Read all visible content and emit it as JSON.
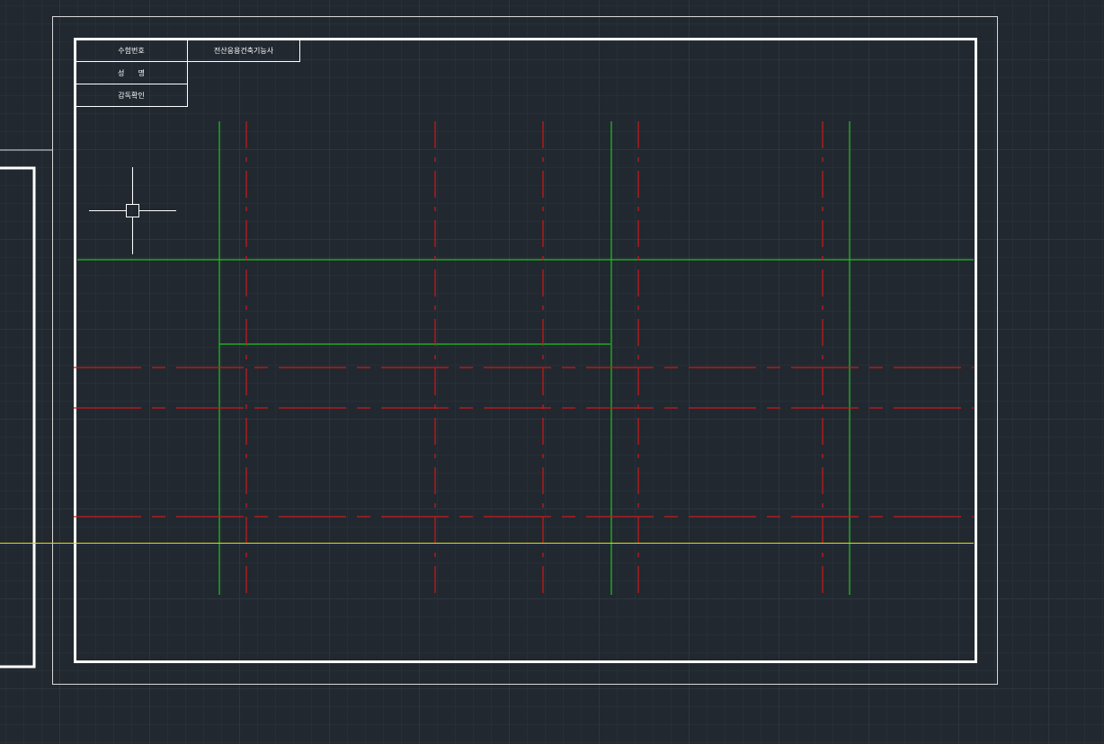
{
  "app": {
    "type": "CAD drawing model space",
    "colors": {
      "background": "#212830",
      "grid_minor": "#2b333d",
      "grid_major": "#36404b",
      "border": "#ffffff",
      "construction_line": "#1fc21f",
      "center_line": "#d01818",
      "baseline": "#e0e000"
    }
  },
  "title_block": {
    "row1_label": "수험번호",
    "row1_value": "전산응용건축기능사",
    "row2_label": "성      명",
    "row3_label": "감독확인"
  },
  "crosshair": {
    "icon": "crosshair-cursor-icon"
  }
}
